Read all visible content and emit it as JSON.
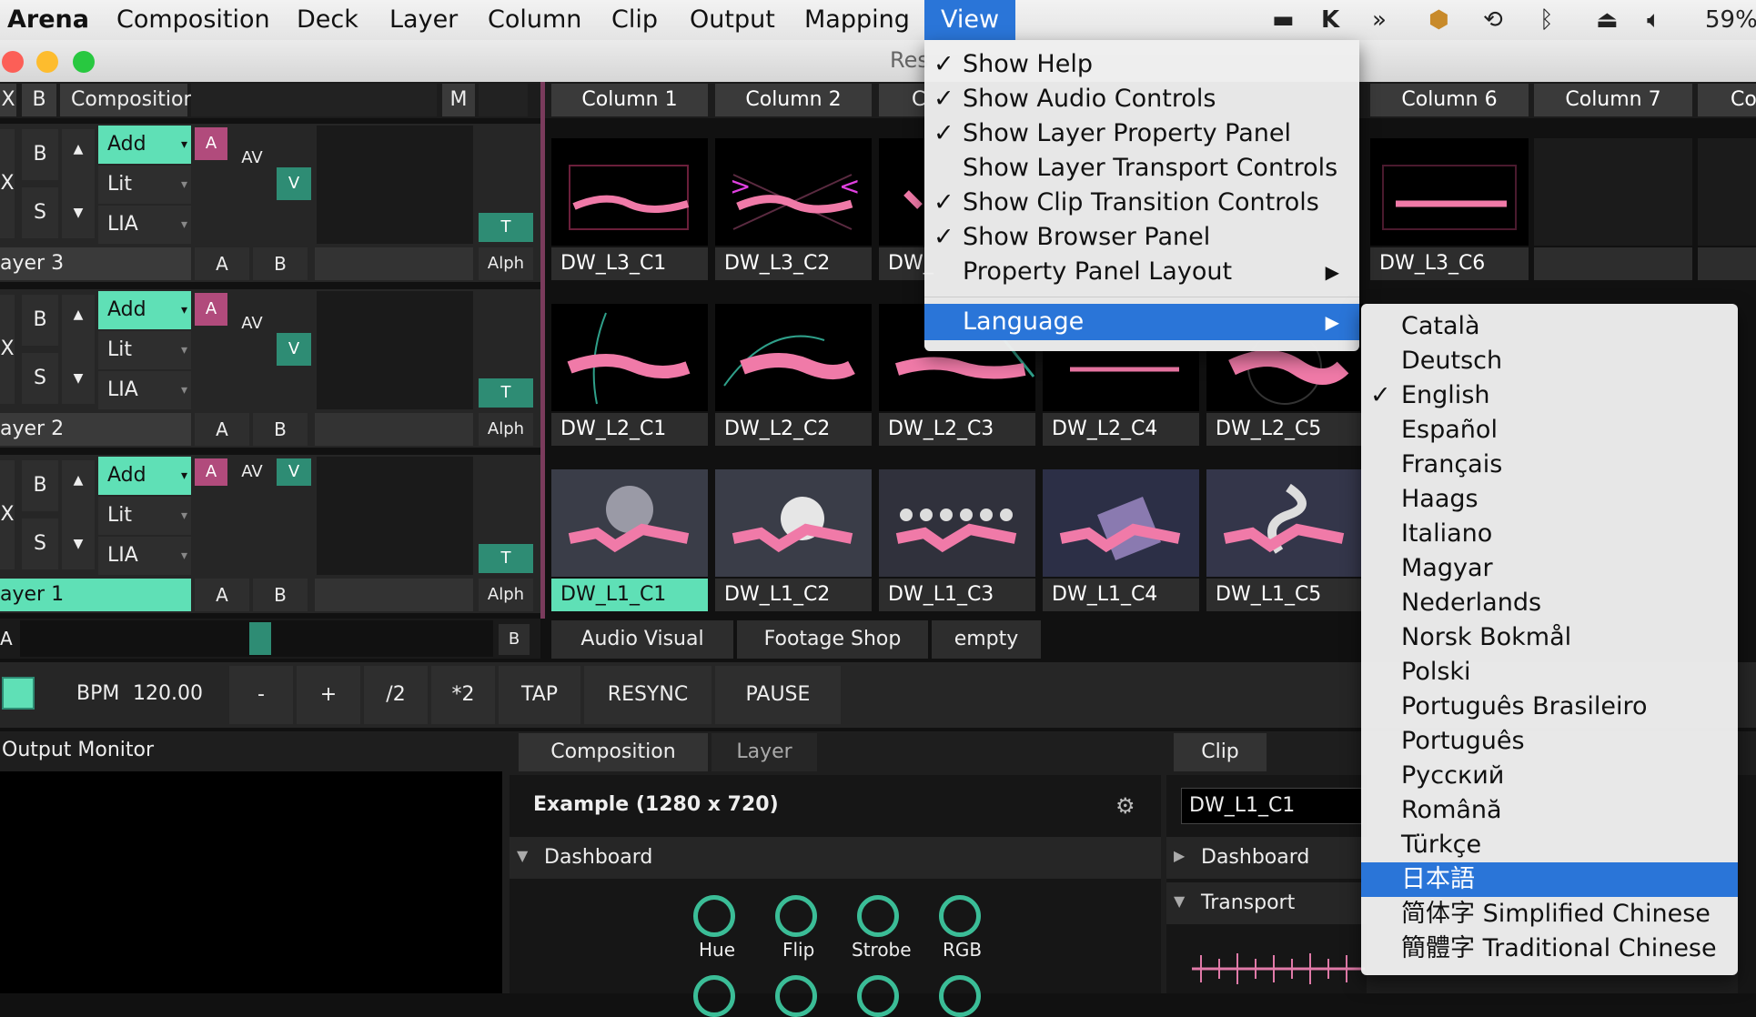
{
  "menubar": {
    "app_name": "Arena",
    "items": [
      "Composition",
      "Deck",
      "Layer",
      "Column",
      "Clip",
      "Output",
      "Mapping",
      "View"
    ],
    "battery": "59%"
  },
  "window": {
    "title_fragment": "Res"
  },
  "composition_header": {
    "x_label": "X",
    "b_label": "B",
    "name": "Composition",
    "m_label": "M"
  },
  "columns": [
    "Column 1",
    "Column 2",
    "C",
    "Column 6",
    "Column 7",
    "Co"
  ],
  "layers": [
    {
      "name": "ayer 3",
      "blend": "Add",
      "opt1": "Lit",
      "opt2": "LIA",
      "b": "B",
      "s": "S",
      "a": "A",
      "av": "AV",
      "v": "V",
      "t": "T",
      "alph": "Alph",
      "ab_a": "A",
      "ab_b": "B",
      "clips": [
        "DW_L3_C1",
        "DW_L3_C2",
        "DW_",
        "DW_L3_C6"
      ]
    },
    {
      "name": "ayer 2",
      "blend": "Add",
      "opt1": "Lit",
      "opt2": "LIA",
      "b": "B",
      "s": "S",
      "a": "A",
      "av": "AV",
      "v": "V",
      "t": "T",
      "alph": "Alph",
      "ab_a": "A",
      "ab_b": "B",
      "clips": [
        "DW_L2_C1",
        "DW_L2_C2",
        "DW_L2_C3",
        "DW_L2_C4",
        "DW_L2_C5"
      ]
    },
    {
      "name": "ayer 1",
      "blend": "Add",
      "opt1": "Lit",
      "opt2": "LIA",
      "b": "B",
      "s": "S",
      "a": "A",
      "av": "AV",
      "v": "V",
      "t": "T",
      "alph": "Alph",
      "ab_a": "A",
      "ab_b": "B",
      "clips": [
        "DW_L1_C1",
        "DW_L1_C2",
        "DW_L1_C3",
        "DW_L1_C4",
        "DW_L1_C5"
      ]
    }
  ],
  "crossfader": {
    "a": "A",
    "b": "B"
  },
  "deck_tabs": [
    "Audio Visual",
    "Footage Shop",
    "empty"
  ],
  "transport": {
    "bpm_label": "BPM",
    "bpm_value": "120.00",
    "buttons": [
      "-",
      "+",
      "/2",
      "*2",
      "TAP",
      "RESYNC",
      "PAUSE"
    ]
  },
  "output_monitor": {
    "title": "Output Monitor"
  },
  "composition_panel": {
    "tabs": [
      "Composition",
      "Layer"
    ],
    "name": "Example (1280 x 720)",
    "section": "Dashboard",
    "knobs": [
      "Hue",
      "Flip",
      "Strobe",
      "RGB"
    ]
  },
  "clip_panel": {
    "tab": "Clip",
    "name": "DW_L1_C1",
    "sections": [
      "Dashboard",
      "Transport"
    ]
  },
  "view_menu": {
    "items": [
      {
        "label": "Show Help",
        "checked": true
      },
      {
        "label": "Show Audio Controls",
        "checked": true
      },
      {
        "label": "Show Layer Property Panel",
        "checked": true
      },
      {
        "label": "Show Layer Transport Controls",
        "checked": false
      },
      {
        "label": "Show Clip Transition Controls",
        "checked": true
      },
      {
        "label": "Show Browser Panel",
        "checked": true
      },
      {
        "label": "Property Panel Layout",
        "checked": false,
        "submenu": true
      },
      {
        "label": "Language",
        "checked": false,
        "submenu": true,
        "highlighted": true
      }
    ]
  },
  "language_menu": {
    "items": [
      "Català",
      "Deutsch",
      "English",
      "Español",
      "Français",
      "Haags",
      "Italiano",
      "Magyar",
      "Nederlands",
      "Norsk Bokmål",
      "Polski",
      "Português Brasileiro",
      "Português",
      "Русский",
      "Română",
      "Türkçe",
      "日本語",
      "简体字 Simplified Chinese",
      "簡體字 Traditional Chinese"
    ],
    "checked": "English",
    "highlighted": "日本語"
  },
  "glyphs": {
    "check": "✓",
    "arrow": "▶",
    "up": "▲",
    "down": "▼",
    "caret": "▾",
    "expand": "▶",
    "collapse": "▼"
  },
  "colors": {
    "accent": "#5fe0b6",
    "teal": "#2e8c74",
    "pink": "#b14b7c",
    "menu_highlight": "#2a75d8"
  }
}
